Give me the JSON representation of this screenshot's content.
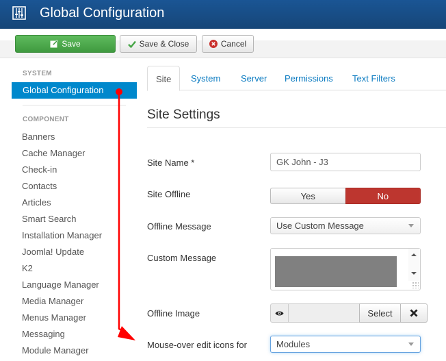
{
  "header": {
    "title": "Global Configuration",
    "icon": "equalizer-sliders-icon",
    "background_color": "#1a5594"
  },
  "toolbar": {
    "save_label": "Save",
    "save_icon": "edit-icon",
    "save_close_label": "Save & Close",
    "save_close_icon": "checkmark-icon",
    "cancel_label": "Cancel",
    "cancel_icon": "cancel-circle-icon",
    "save_color": "#4caa4c"
  },
  "sidebar": {
    "system_heading": "SYSTEM",
    "active_item": "Global Configuration",
    "component_heading": "COMPONENT",
    "active_color": "#0088cc",
    "items": [
      {
        "label": "Banners"
      },
      {
        "label": "Cache Manager"
      },
      {
        "label": "Check-in"
      },
      {
        "label": "Contacts"
      },
      {
        "label": "Articles"
      },
      {
        "label": "Smart Search"
      },
      {
        "label": "Installation Manager"
      },
      {
        "label": "Joomla! Update"
      },
      {
        "label": "K2"
      },
      {
        "label": "Language Manager"
      },
      {
        "label": "Media Manager"
      },
      {
        "label": "Menus Manager"
      },
      {
        "label": "Messaging"
      },
      {
        "label": "Module Manager"
      }
    ]
  },
  "tabs": [
    {
      "label": "Site",
      "active": true
    },
    {
      "label": "System",
      "active": false
    },
    {
      "label": "Server",
      "active": false
    },
    {
      "label": "Permissions",
      "active": false
    },
    {
      "label": "Text Filters",
      "active": false
    }
  ],
  "main": {
    "section_title": "Site Settings",
    "fields": {
      "site_name": {
        "label": "Site Name *",
        "value": "GK John - J3"
      },
      "site_offline": {
        "label": "Site Offline",
        "options": [
          "Yes",
          "No"
        ],
        "selected": "No",
        "selected_color": "#bd362f"
      },
      "offline_message": {
        "label": "Offline Message",
        "value": "Use Custom Message"
      },
      "custom_message": {
        "label": "Custom Message",
        "value_redacted": true
      },
      "offline_image": {
        "label": "Offline Image",
        "preview_icon": "eye-icon",
        "select_label": "Select",
        "clear_icon": "close-x-icon"
      },
      "mouseover_edit_icons": {
        "label": "Mouse-over edit icons for",
        "value": "Modules"
      }
    }
  },
  "annotation": {
    "type": "arrow",
    "color": "#ff0000",
    "from": "sidebar-global-configuration",
    "to": "mouseover-edit-icons-label"
  }
}
